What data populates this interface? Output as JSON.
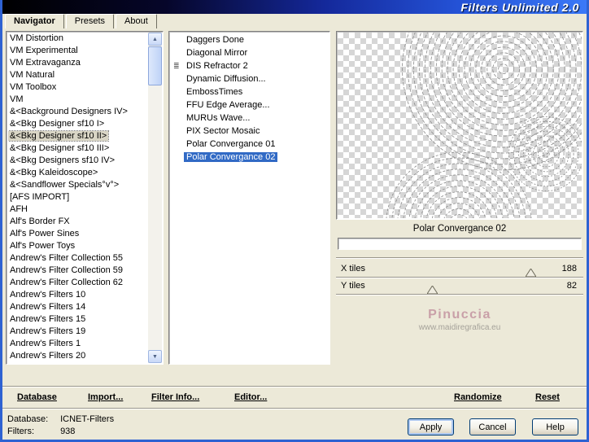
{
  "window": {
    "title": "Filters Unlimited 2.0"
  },
  "tabs": [
    {
      "label": "Navigator",
      "active": true
    },
    {
      "label": "Presets",
      "active": false
    },
    {
      "label": "About",
      "active": false
    }
  ],
  "category_list": {
    "selected_index": 8,
    "items": [
      "VM Distortion",
      "VM Experimental",
      "VM Extravaganza",
      "VM Natural",
      "VM Toolbox",
      "VM",
      "&<Background Designers IV>",
      "&<Bkg Designer sf10 I>",
      "&<Bkg Designer sf10 II>",
      "&<Bkg Designer sf10 III>",
      "&<Bkg Designers sf10 IV>",
      "&<Bkg Kaleidoscope>",
      "&<Sandflower Specials°v°>",
      "[AFS IMPORT]",
      "AFH",
      "Alf's Border FX",
      "Alf's Power Sines",
      "Alf's Power Toys",
      "Andrew's Filter Collection 55",
      "Andrew's Filter Collection 59",
      "Andrew's Filter Collection 62",
      "Andrew's Filters 10",
      "Andrew's Filters 14",
      "Andrew's Filters 15",
      "Andrew's Filters 19",
      "Andrew's Filters 1",
      "Andrew's Filters 20"
    ]
  },
  "filter_list": {
    "selected_index": 9,
    "items": [
      {
        "label": "Daggers Done"
      },
      {
        "label": "Diagonal Mirror"
      },
      {
        "label": "DIS Refractor 2",
        "icon": "stack-icon"
      },
      {
        "label": "Dynamic Diffusion..."
      },
      {
        "label": "EmbossTimes"
      },
      {
        "label": "FFU Edge Average..."
      },
      {
        "label": "MURUs Wave..."
      },
      {
        "label": "PIX Sector Mosaic"
      },
      {
        "label": "Polar Convergance 01"
      },
      {
        "label": "Polar Convergance 02"
      }
    ]
  },
  "preview": {
    "caption": "Polar Convergance 02"
  },
  "params": [
    {
      "label": "X tiles",
      "value": "188",
      "thumb_pct": 79
    },
    {
      "label": "Y tiles",
      "value": "82",
      "thumb_pct": 39
    }
  ],
  "watermark": {
    "name": "Pinuccia",
    "url": "www.maidiregrafica.eu"
  },
  "toolbar": {
    "database": "Database",
    "import": "Import...",
    "filter_info": "Filter Info...",
    "editor": "Editor...",
    "randomize": "Randomize",
    "reset": "Reset"
  },
  "status": {
    "database_label": "Database:",
    "database_value": "ICNET-Filters",
    "filters_label": "Filters:",
    "filters_value": "938"
  },
  "buttons": {
    "apply": "Apply",
    "cancel": "Cancel",
    "help": "Help"
  },
  "icons": {
    "scroll_up": "▲",
    "scroll_down": "▼",
    "stack-icon": "≣"
  },
  "colors": {
    "selection": "#316AC5",
    "titlebar_left": "#000000",
    "titlebar_right": "#3B79F8",
    "watermark_pink": "#C9A0A8",
    "background": "#ECE9D8"
  }
}
